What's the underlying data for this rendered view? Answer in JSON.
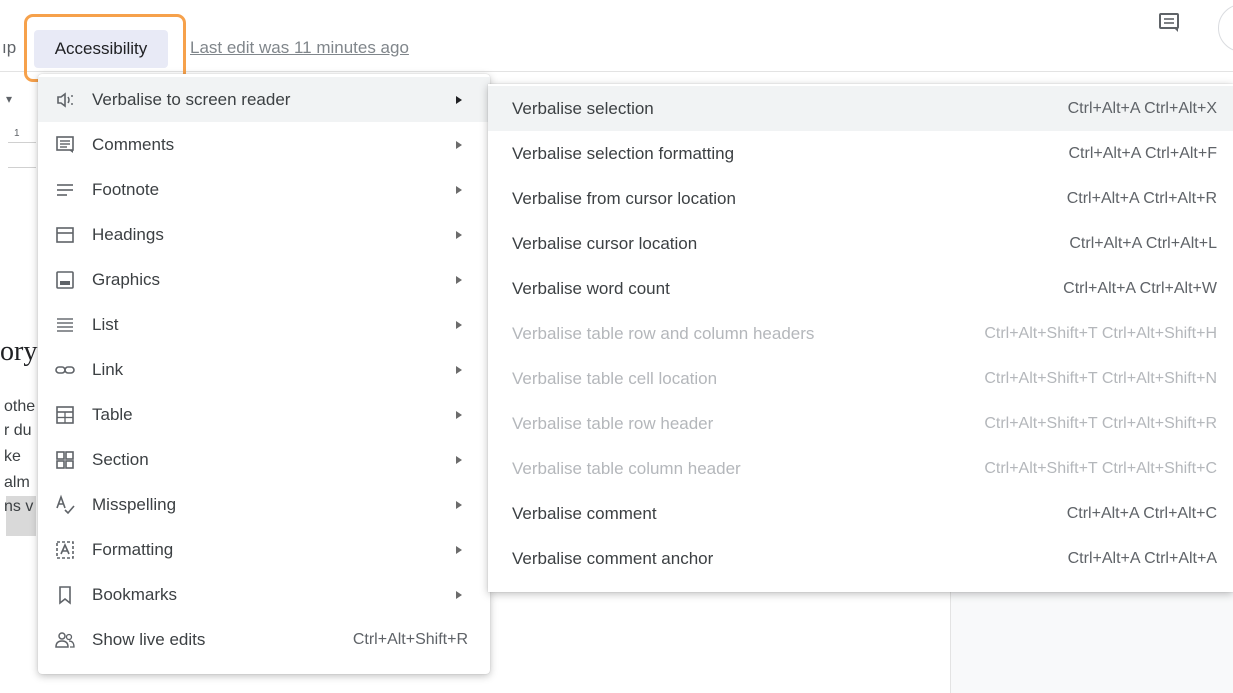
{
  "menubar": {
    "partial_left": "ıp",
    "accessibility_label": "Accessibility",
    "last_edit": "Last edit was 11 minutes ago"
  },
  "document": {
    "ruler_arrow": "▾",
    "ruler_number": "1",
    "heading_fragment": "ory",
    "text_fragments": [
      "othe",
      "r du",
      "ke",
      "alm",
      "ns v"
    ]
  },
  "accessibility_menu": {
    "items": [
      {
        "label": "Verbalise to screen reader",
        "icon": "speaker-icon",
        "has_submenu": true
      },
      {
        "label": "Comments",
        "icon": "comment-icon",
        "has_submenu": true
      },
      {
        "label": "Footnote",
        "icon": "footnote-icon",
        "has_submenu": true
      },
      {
        "label": "Headings",
        "icon": "headings-icon",
        "has_submenu": true
      },
      {
        "label": "Graphics",
        "icon": "image-icon",
        "has_submenu": true
      },
      {
        "label": "List",
        "icon": "list-icon",
        "has_submenu": true
      },
      {
        "label": "Link",
        "icon": "link-icon",
        "has_submenu": true
      },
      {
        "label": "Table",
        "icon": "table-icon",
        "has_submenu": true
      },
      {
        "label": "Section",
        "icon": "section-icon",
        "has_submenu": true
      },
      {
        "label": "Misspelling",
        "icon": "spellcheck-icon",
        "has_submenu": true
      },
      {
        "label": "Formatting",
        "icon": "format-icon",
        "has_submenu": true
      },
      {
        "label": "Bookmarks",
        "icon": "bookmark-icon",
        "has_submenu": true
      },
      {
        "label": "Show live edits",
        "icon": "people-icon",
        "shortcut": "Ctrl+Alt+Shift+R"
      }
    ]
  },
  "verbalise_submenu": {
    "items": [
      {
        "label": "Verbalise selection",
        "shortcut": "Ctrl+Alt+A Ctrl+Alt+X",
        "enabled": true
      },
      {
        "label": "Verbalise selection formatting",
        "shortcut": "Ctrl+Alt+A Ctrl+Alt+F",
        "enabled": true
      },
      {
        "label": "Verbalise from cursor location",
        "shortcut": "Ctrl+Alt+A Ctrl+Alt+R",
        "enabled": true
      },
      {
        "label": "Verbalise cursor location",
        "shortcut": "Ctrl+Alt+A Ctrl+Alt+L",
        "enabled": true
      },
      {
        "label": "Verbalise word count",
        "shortcut": "Ctrl+Alt+A Ctrl+Alt+W",
        "enabled": true
      },
      {
        "label": "Verbalise table row and column headers",
        "shortcut": "Ctrl+Alt+Shift+T Ctrl+Alt+Shift+H",
        "enabled": false
      },
      {
        "label": "Verbalise table cell location",
        "shortcut": "Ctrl+Alt+Shift+T Ctrl+Alt+Shift+N",
        "enabled": false
      },
      {
        "label": "Verbalise table row header",
        "shortcut": "Ctrl+Alt+Shift+T Ctrl+Alt+Shift+R",
        "enabled": false
      },
      {
        "label": "Verbalise table column header",
        "shortcut": "Ctrl+Alt+Shift+T Ctrl+Alt+Shift+C",
        "enabled": false
      },
      {
        "label": "Verbalise comment",
        "shortcut": "Ctrl+Alt+A Ctrl+Alt+C",
        "enabled": true
      },
      {
        "label": "Verbalise comment anchor",
        "shortcut": "Ctrl+Alt+A Ctrl+Alt+A",
        "enabled": true
      }
    ]
  },
  "colors": {
    "highlight_border": "#f6a14b",
    "menu_active_bg": "#f1f3f4",
    "menu_button_bg": "#e8eaf6",
    "disabled_text": "#b4b7bb"
  }
}
